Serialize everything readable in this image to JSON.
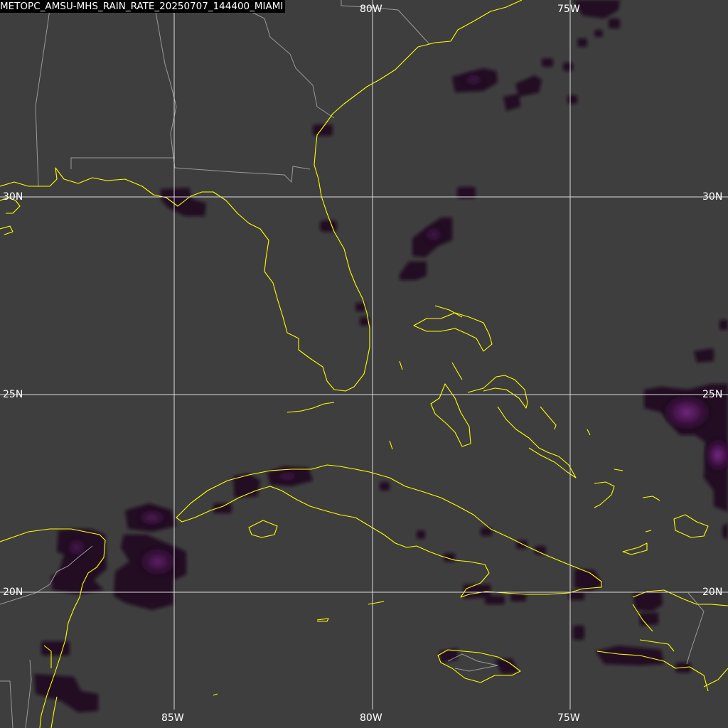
{
  "title": "METOPC_AMSU-MHS_RAIN_RATE_20250707_144400_MIAMI",
  "grid": {
    "lon_labels": [
      "85W",
      "80W",
      "75W"
    ],
    "lat_labels": [
      "30N",
      "25N",
      "20N"
    ]
  },
  "colors": {
    "background": "#3e3e3e",
    "coastline": "#ffff00",
    "borders": "#9a9a9a",
    "graticule": "#ffffff",
    "rain_low": "#220822",
    "rain_mid": "#4a1650",
    "rain_high": "#7a2a8a"
  },
  "layers": [
    "coastlines",
    "political-borders",
    "lat-lon-grid",
    "rain-rate"
  ]
}
